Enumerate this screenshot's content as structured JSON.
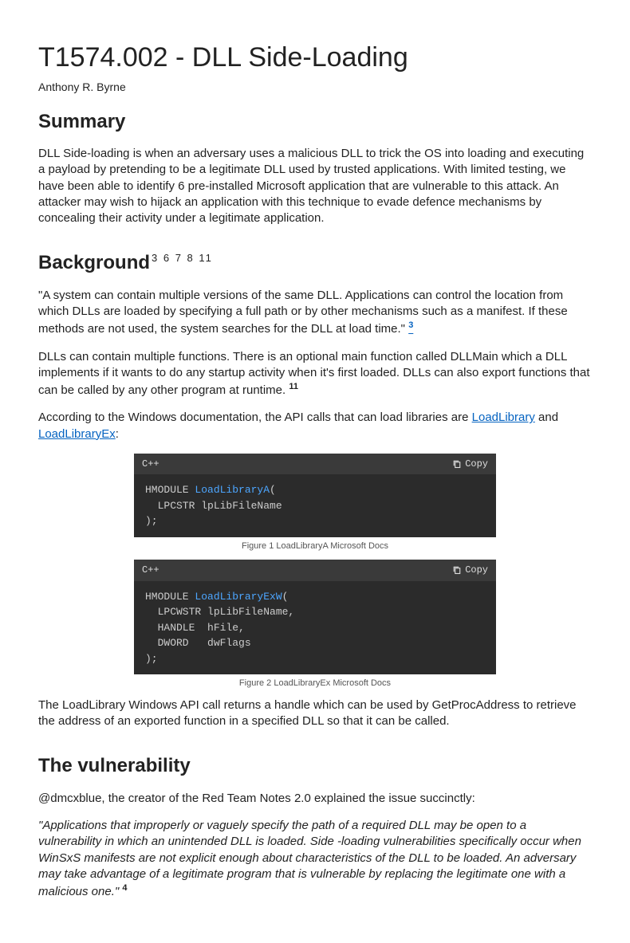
{
  "title": "T1574.002 - DLL Side-Loading",
  "author": "Anthony R. Byrne",
  "summary": {
    "heading": "Summary",
    "body": "DLL Side-loading is when an adversary uses a malicious DLL to trick the OS into loading and executing a payload by pretending to be a legitimate DLL used by trusted applications. With limited testing, we have been able to identify 6 pre-installed Microsoft application that are vulnerable to this attack. An attacker may wish to hijack an application with this technique to evade defence mechanisms by concealing their activity under a legitimate application."
  },
  "background": {
    "heading": "Background",
    "refs": "3 6 7 8 11",
    "p1_text": "\"A system can contain multiple versions of the same DLL. Applications can control the location from which DLLs are loaded by specifying a full path or by other mechanisms such as a manifest. If these methods are not used, the system searches for the DLL at load time.\" ",
    "p1_ref": "3",
    "p2_text": "DLLs can contain multiple functions. There is an optional main function called DLLMain which a DLL implements if it wants to do any startup activity when it's first loaded. DLLs can also export functions that can be called by any other program at runtime. ",
    "p2_ref": "11",
    "p3_pre": "According to the Windows documentation, the API calls that can load libraries are ",
    "link1": "LoadLibrary",
    "p3_mid": " and ",
    "link2": "LoadLibraryEx",
    "p3_end": ":",
    "code1": {
      "lang": "C++",
      "copy": "Copy",
      "caption": "Figure 1 LoadLibraryA Microsoft Docs",
      "l1a": "HMODULE ",
      "l1b": "LoadLibraryA",
      "l1c": "(",
      "l2": "  LPCSTR lpLibFileName",
      "l3": ");"
    },
    "code2": {
      "lang": "C++",
      "copy": "Copy",
      "caption": "Figure 2 LoadLibraryEx Microsoft Docs",
      "l1a": "HMODULE ",
      "l1b": "LoadLibraryExW",
      "l1c": "(",
      "l2": "  LPCWSTR lpLibFileName,",
      "l3": "  HANDLE  hFile,",
      "l4": "  DWORD   dwFlags",
      "l5": ");"
    },
    "p4": "The LoadLibrary Windows API call returns a handle which can be used by GetProcAddress to retrieve the address of an exported function in a specified DLL so that it can be called."
  },
  "vuln": {
    "heading": "The vulnerability",
    "p1": "@dmcxblue, the creator of the Red Team Notes 2.0 explained the issue succinctly:",
    "quote": "\"Applications that improperly or vaguely specify the path of a required DLL may be open to a vulnerability in which an unintended DLL is loaded. Side -loading vulnerabilities specifically occur when WinSxS manifests are not explicit enough about characteristics of the DLL to be loaded. An adversary may take advantage of a legitimate program that is vulnerable by replacing the legitimate one with a malicious one.\" ",
    "quote_ref": "4"
  }
}
